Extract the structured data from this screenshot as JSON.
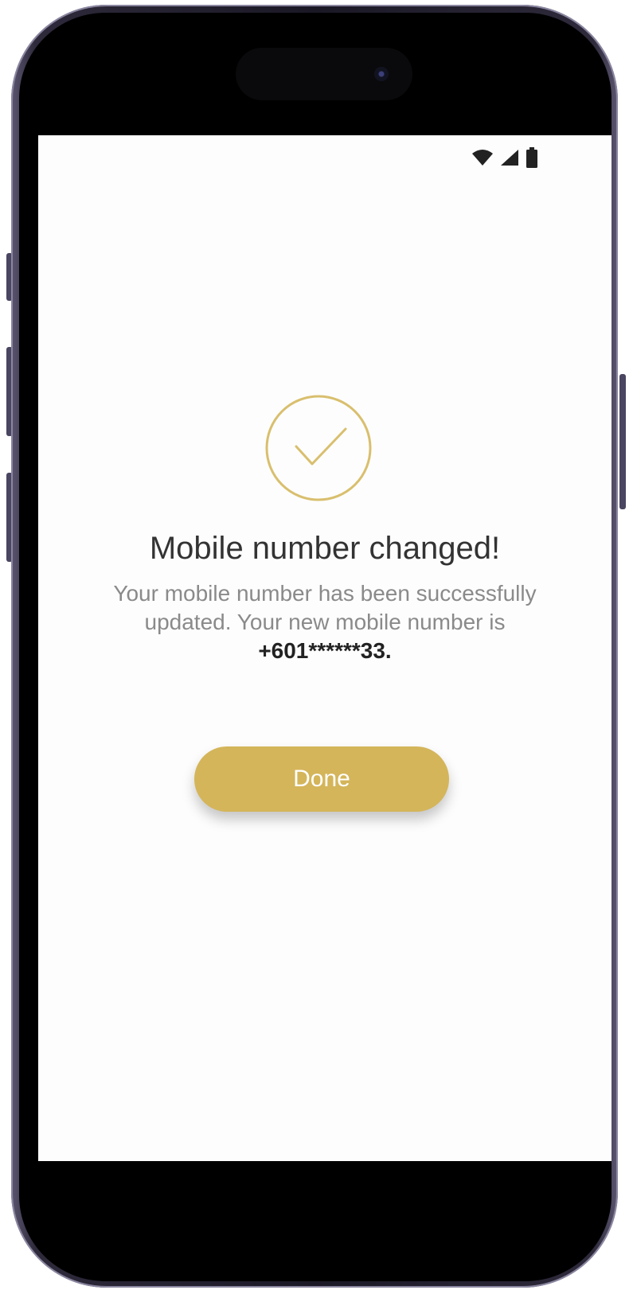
{
  "status_bar": {
    "icons": [
      "wifi-icon",
      "cellular-signal-icon",
      "battery-icon"
    ]
  },
  "success": {
    "icon": "checkmark-circle-icon",
    "accent_color": "#d4b55a"
  },
  "confirmation": {
    "title": "Mobile number changed!",
    "message": "Your mobile number has been successfully updated. Your new mobile number is",
    "masked_number": "+601******33."
  },
  "actions": {
    "done_label": "Done"
  },
  "colors": {
    "button": "#d4b55a",
    "title_text": "#333333",
    "body_text": "#8a8a8a",
    "screen_background": "#fdfdfd"
  }
}
